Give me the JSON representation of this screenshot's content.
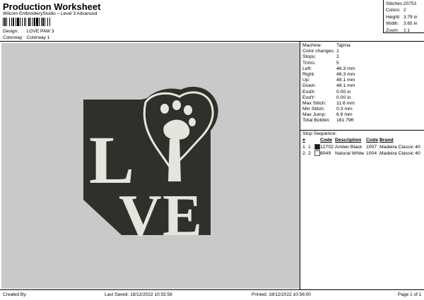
{
  "header": {
    "title": "Production Worksheet",
    "subtitle": "Wilcom EmbroideryStudio – Level 3 Advanced",
    "design_label": "Design:",
    "design_value": "LOVE PAW 3",
    "colorway_label": "Colorway:",
    "colorway_value": "Colorway 1"
  },
  "summary": [
    {
      "label": "Stitches:",
      "value": "20753"
    },
    {
      "label": "Colors:",
      "value": "2"
    },
    {
      "label": "Height:",
      "value": "3.79 in"
    },
    {
      "label": "Width:",
      "value": "3.65 in"
    },
    {
      "label": "Zoom:",
      "value": "1:1"
    }
  ],
  "machine_info": [
    {
      "label": "Machine:",
      "value": "Tajima"
    },
    {
      "label": "Color changes:",
      "value": "1"
    },
    {
      "label": "Stops:",
      "value": "2"
    },
    {
      "label": "Trims:",
      "value": "5"
    },
    {
      "label": "Left:",
      "value": "46.3 mm"
    },
    {
      "label": "Right:",
      "value": "46.3 mm"
    },
    {
      "label": "Up:",
      "value": "48.1 mm"
    },
    {
      "label": "Down:",
      "value": "48.1 mm"
    },
    {
      "label": "EndX:",
      "value": "0.00 in"
    },
    {
      "label": "EndY:",
      "value": "0.00 in"
    },
    {
      "label": "Max Stitch:",
      "value": "11.6 mm"
    },
    {
      "label": "Min Stitch:",
      "value": "0.3 mm"
    },
    {
      "label": "Max Jump:",
      "value": "6.9 mm"
    },
    {
      "label": "Total Bobbin:",
      "value": "161.79ft"
    }
  ],
  "stop_sequence": {
    "title": "Stop Sequence:",
    "columns": [
      "#",
      "",
      "",
      "Code",
      "Description",
      "Code",
      "Brand"
    ],
    "rows": [
      {
        "index": "1.",
        "stop": "1",
        "swatch_color": "#1a1a1a",
        "code": "12702",
        "description": "Amber Black",
        "thread_code": "1007",
        "brand": "Madeira Classic 40"
      },
      {
        "index": "2.",
        "stop": "2",
        "swatch_color": "#f2f2ec",
        "code": "8049",
        "description": "Natural White",
        "thread_code": "1004",
        "brand": "Madeira Classic 40"
      }
    ]
  },
  "design_preview": {
    "background_color": "#c9c9c9",
    "fill_color": "#2f302b",
    "stitch_color": "#e4e6de",
    "letters": [
      "L",
      "V",
      "E"
    ]
  },
  "footer": {
    "created_by": "Created By:",
    "last_saved": "Last Saved: 18/12/2022 10:55:58",
    "printed": "Printed: 18/12/2022 10:56:00",
    "page": "Page 1 of 1"
  }
}
